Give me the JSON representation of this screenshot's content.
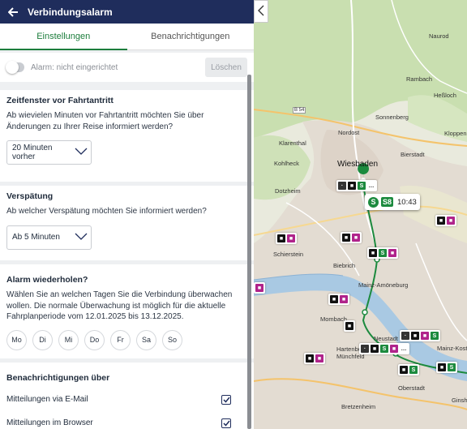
{
  "header": {
    "title": "Verbindungsalarm"
  },
  "tabs": [
    {
      "label": "Einstellungen",
      "active": true
    },
    {
      "label": "Benachrichtigungen",
      "active": false
    }
  ],
  "alarm": {
    "status_label": "Alarm: nicht eingerichtet",
    "delete_label": "Löschen",
    "enabled": false
  },
  "time_window": {
    "title": "Zeitfenster vor Fahrtantritt",
    "description": "Ab wievielen Minuten vor Fahrtantritt möchten Sie über Änderungen zu Ihrer Reise informiert werden?",
    "selected": "20 Minuten vorher"
  },
  "delay": {
    "title": "Verspätung",
    "description": "Ab welcher Verspätung möchten Sie informiert werden?",
    "selected": "Ab 5 Minuten"
  },
  "repeat": {
    "title": "Alarm wiederholen?",
    "description": "Wählen Sie an welchen Tagen Sie die Verbindung überwachen wollen. Die normale Überwachung ist möglich für die aktuelle Fahrplanperiode vom 12.01.2025 bis 13.12.2025.",
    "days": [
      "Mo",
      "Di",
      "Mi",
      "Do",
      "Fr",
      "Sa",
      "So"
    ]
  },
  "notifications": {
    "title": "Benachrichtigungen über",
    "options": [
      {
        "label": "Mitteilungen via E-Mail",
        "checked": true
      },
      {
        "label": "Mitteilungen im Browser",
        "checked": true
      }
    ]
  },
  "map": {
    "places": [
      "Naurod",
      "Rambach",
      "Heßloch",
      "Sonnenberg",
      "Nordost",
      "Klarenthal",
      "Bierstadt",
      "Kohlheck",
      "Wiesbaden",
      "Dotzheim",
      "Schierstein",
      "Biebrich",
      "Mainz-Amöneburg",
      "Mombach",
      "Neustadt",
      "Hartenberg Münchfeld",
      "Oberstadt",
      "Bretzenheim",
      "Ginsheim",
      "Kloppenheim",
      "Mainz-Kostheim"
    ],
    "road_label": "B 54",
    "popup": {
      "service": "S",
      "line": "S8",
      "time": "10:43"
    }
  },
  "colors": {
    "header_bg": "#1f2d5c",
    "accent_green": "#1c7d3c",
    "tram": "#b0238b",
    "sbahn": "#1c8a3e"
  },
  "icons": {
    "back": "arrow-left-icon",
    "collapse": "chevron-left-icon",
    "select": "chevron-down-icon",
    "check": "checkmark-icon"
  }
}
